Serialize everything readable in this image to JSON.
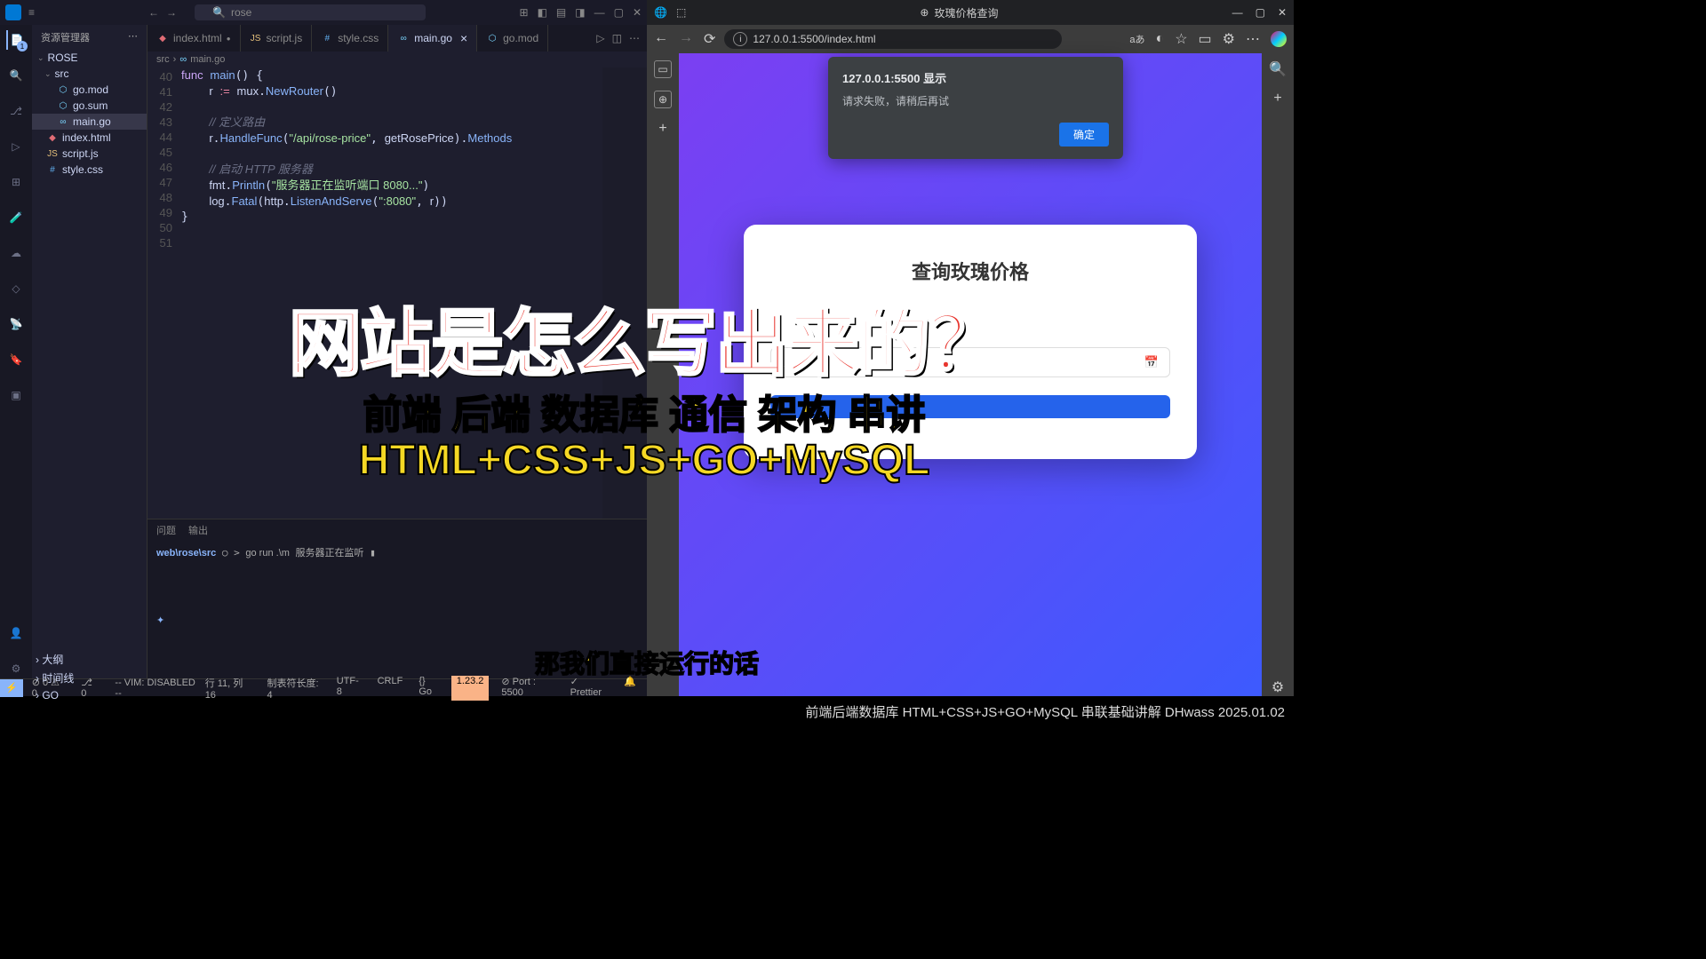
{
  "vscode": {
    "search_placeholder": "rose",
    "sidebar_title": "资源管理器",
    "project_name": "ROSE",
    "folders": {
      "src": "src"
    },
    "files": {
      "gomod": "go.mod",
      "gosum": "go.sum",
      "maingo": "main.go",
      "indexhtml": "index.html",
      "scriptjs": "script.js",
      "stylecss": "style.css"
    },
    "outline": {
      "daguan": "大纲",
      "timeline": "时间线",
      "go": "GO"
    },
    "tabs": {
      "indexhtml": "index.html",
      "scriptjs": "script.js",
      "stylecss": "style.css",
      "maingo": "main.go",
      "gomod": "go.mod"
    },
    "breadcrumb": {
      "src": "src",
      "maingo": "main.go"
    },
    "code": {
      "l40": "40",
      "l41": "41",
      "l42": "42",
      "l43": "43",
      "l44": "44",
      "l45": "45",
      "l46": "46",
      "l47": "47",
      "l48": "48",
      "l49": "49",
      "l50": "50",
      "l51": "51",
      "func": "func",
      "main": "main",
      "r_var": "r",
      "op_assign": ":=",
      "mux": "mux",
      "newrouter": "NewRouter",
      "cm_route": "// 定义路由",
      "handlefunc": "HandleFunc",
      "api_path": "\"/api/rose-price\"",
      "getroseprice": "getRosePrice",
      "methods": "Methods",
      "cm_http": "// 启动 HTTP 服务器",
      "fmt": "fmt",
      "println": "Println",
      "listen_msg": "\"服务器正在监听端口 8080...\"",
      "log": "log",
      "fatal": "Fatal",
      "http": "http",
      "las": "ListenAndServe",
      "port": "\":8080\"",
      "r_arg": "r"
    },
    "terminal": {
      "tab_problems": "问题",
      "tab_output": "输出",
      "path": "web\\rose\\src",
      "cmd": "go run .\\m",
      "listening": "服务器正在监听"
    },
    "statusbar": {
      "errors": "0",
      "warnings": "0",
      "info": "0",
      "vim": "-- VIM: DISABLED --",
      "cursor": "行 11, 列 16",
      "tabsize": "制表符长度: 4",
      "encoding": "UTF-8",
      "eol": "CRLF",
      "lang": "Go",
      "gover": "1.23.2",
      "port": "Port : 5500",
      "prettier": "Prettier"
    }
  },
  "browser": {
    "title": "玫瑰价格查询",
    "url": "127.0.0.1:5500/index.html",
    "alert": {
      "title": "127.0.0.1:5500 显示",
      "message": "请求失败，请稍后再试",
      "ok": "确定"
    },
    "card": {
      "heading": "查询玫瑰价格",
      "date_placeholder": "",
      "button": ""
    }
  },
  "overlay": {
    "line1": "网站是怎么写出来的？",
    "line2": "前端 后端 数据库 通信 架构 串讲",
    "line3": "HTML+CSS+JS+GO+MySQL"
  },
  "subtitle": "那我们直接运行的话",
  "footer": "前端后端数据库 HTML+CSS+JS+GO+MySQL 串联基础讲解 DHwass 2025.01.02"
}
